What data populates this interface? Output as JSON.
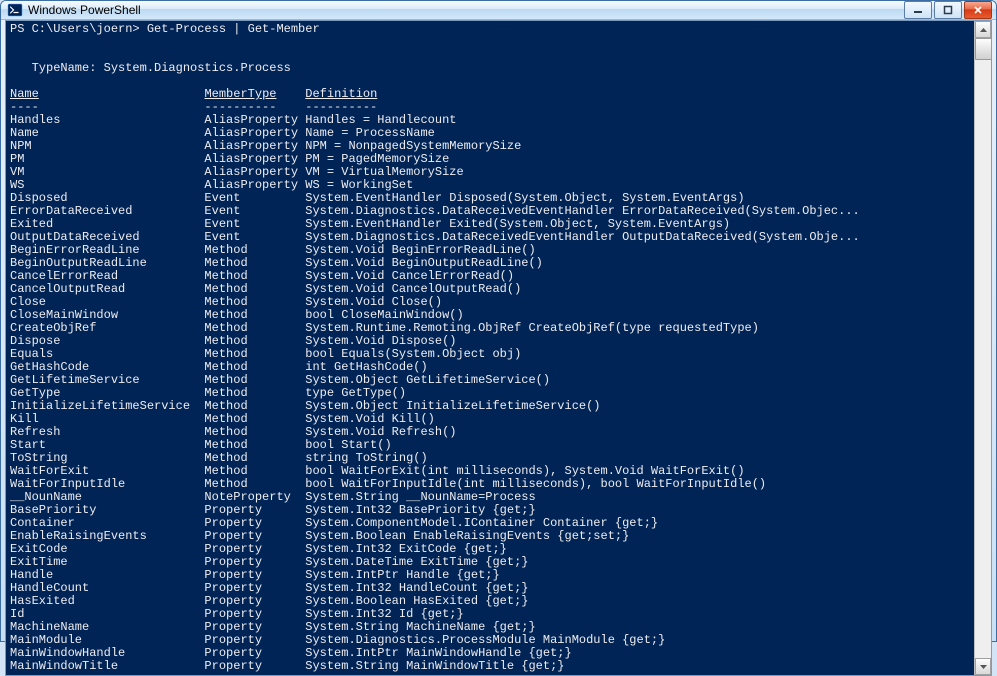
{
  "window": {
    "title": "Windows PowerShell"
  },
  "console": {
    "prompt_prefix": "PS ",
    "cwd": "C:\\Users\\joern",
    "command": "Get-Process | Get-Member",
    "typename_label": "   TypeName: ",
    "typename_value": "System.Diagnostics.Process",
    "headers": {
      "name": "Name",
      "membertype": "MemberType",
      "definition": "Definition"
    },
    "rows": [
      {
        "name": "Handles",
        "type": "AliasProperty",
        "def": "Handles = Handlecount"
      },
      {
        "name": "Name",
        "type": "AliasProperty",
        "def": "Name = ProcessName"
      },
      {
        "name": "NPM",
        "type": "AliasProperty",
        "def": "NPM = NonpagedSystemMemorySize"
      },
      {
        "name": "PM",
        "type": "AliasProperty",
        "def": "PM = PagedMemorySize"
      },
      {
        "name": "VM",
        "type": "AliasProperty",
        "def": "VM = VirtualMemorySize"
      },
      {
        "name": "WS",
        "type": "AliasProperty",
        "def": "WS = WorkingSet"
      },
      {
        "name": "Disposed",
        "type": "Event",
        "def": "System.EventHandler Disposed(System.Object, System.EventArgs)"
      },
      {
        "name": "ErrorDataReceived",
        "type": "Event",
        "def": "System.Diagnostics.DataReceivedEventHandler ErrorDataReceived(System.Objec..."
      },
      {
        "name": "Exited",
        "type": "Event",
        "def": "System.EventHandler Exited(System.Object, System.EventArgs)"
      },
      {
        "name": "OutputDataReceived",
        "type": "Event",
        "def": "System.Diagnostics.DataReceivedEventHandler OutputDataReceived(System.Obje..."
      },
      {
        "name": "BeginErrorReadLine",
        "type": "Method",
        "def": "System.Void BeginErrorReadLine()"
      },
      {
        "name": "BeginOutputReadLine",
        "type": "Method",
        "def": "System.Void BeginOutputReadLine()"
      },
      {
        "name": "CancelErrorRead",
        "type": "Method",
        "def": "System.Void CancelErrorRead()"
      },
      {
        "name": "CancelOutputRead",
        "type": "Method",
        "def": "System.Void CancelOutputRead()"
      },
      {
        "name": "Close",
        "type": "Method",
        "def": "System.Void Close()"
      },
      {
        "name": "CloseMainWindow",
        "type": "Method",
        "def": "bool CloseMainWindow()"
      },
      {
        "name": "CreateObjRef",
        "type": "Method",
        "def": "System.Runtime.Remoting.ObjRef CreateObjRef(type requestedType)"
      },
      {
        "name": "Dispose",
        "type": "Method",
        "def": "System.Void Dispose()"
      },
      {
        "name": "Equals",
        "type": "Method",
        "def": "bool Equals(System.Object obj)"
      },
      {
        "name": "GetHashCode",
        "type": "Method",
        "def": "int GetHashCode()"
      },
      {
        "name": "GetLifetimeService",
        "type": "Method",
        "def": "System.Object GetLifetimeService()"
      },
      {
        "name": "GetType",
        "type": "Method",
        "def": "type GetType()"
      },
      {
        "name": "InitializeLifetimeService",
        "type": "Method",
        "def": "System.Object InitializeLifetimeService()"
      },
      {
        "name": "Kill",
        "type": "Method",
        "def": "System.Void Kill()"
      },
      {
        "name": "Refresh",
        "type": "Method",
        "def": "System.Void Refresh()"
      },
      {
        "name": "Start",
        "type": "Method",
        "def": "bool Start()"
      },
      {
        "name": "ToString",
        "type": "Method",
        "def": "string ToString()"
      },
      {
        "name": "WaitForExit",
        "type": "Method",
        "def": "bool WaitForExit(int milliseconds), System.Void WaitForExit()"
      },
      {
        "name": "WaitForInputIdle",
        "type": "Method",
        "def": "bool WaitForInputIdle(int milliseconds), bool WaitForInputIdle()"
      },
      {
        "name": "__NounName",
        "type": "NoteProperty",
        "def": "System.String __NounName=Process"
      },
      {
        "name": "BasePriority",
        "type": "Property",
        "def": "System.Int32 BasePriority {get;}"
      },
      {
        "name": "Container",
        "type": "Property",
        "def": "System.ComponentModel.IContainer Container {get;}"
      },
      {
        "name": "EnableRaisingEvents",
        "type": "Property",
        "def": "System.Boolean EnableRaisingEvents {get;set;}"
      },
      {
        "name": "ExitCode",
        "type": "Property",
        "def": "System.Int32 ExitCode {get;}"
      },
      {
        "name": "ExitTime",
        "type": "Property",
        "def": "System.DateTime ExitTime {get;}"
      },
      {
        "name": "Handle",
        "type": "Property",
        "def": "System.IntPtr Handle {get;}"
      },
      {
        "name": "HandleCount",
        "type": "Property",
        "def": "System.Int32 HandleCount {get;}"
      },
      {
        "name": "HasExited",
        "type": "Property",
        "def": "System.Boolean HasExited {get;}"
      },
      {
        "name": "Id",
        "type": "Property",
        "def": "System.Int32 Id {get;}"
      },
      {
        "name": "MachineName",
        "type": "Property",
        "def": "System.String MachineName {get;}"
      },
      {
        "name": "MainModule",
        "type": "Property",
        "def": "System.Diagnostics.ProcessModule MainModule {get;}"
      },
      {
        "name": "MainWindowHandle",
        "type": "Property",
        "def": "System.IntPtr MainWindowHandle {get;}"
      },
      {
        "name": "MainWindowTitle",
        "type": "Property",
        "def": "System.String MainWindowTitle {get;}"
      }
    ],
    "col_widths": {
      "name": 27,
      "type": 14
    }
  }
}
